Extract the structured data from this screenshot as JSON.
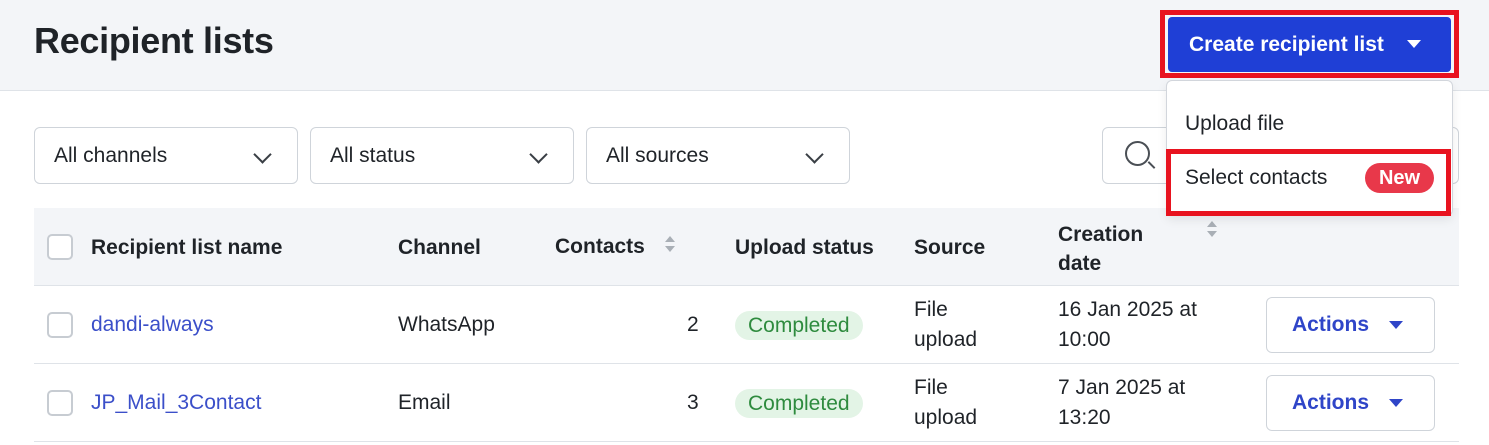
{
  "header": {
    "title": "Recipient lists",
    "create_label": "Create recipient list"
  },
  "dropdown": {
    "items": [
      {
        "label": "Upload file"
      },
      {
        "label": "Select contacts",
        "badge": "New"
      }
    ]
  },
  "filters": [
    {
      "label": "All channels"
    },
    {
      "label": "All status"
    },
    {
      "label": "All sources"
    }
  ],
  "table": {
    "headers": {
      "name": "Recipient list name",
      "channel": "Channel",
      "contacts": "Contacts",
      "upload_status": "Upload status",
      "source": "Source",
      "creation_line1": "Creation",
      "creation_line2": "date"
    },
    "rows": [
      {
        "name": "dandi-always",
        "channel": "WhatsApp",
        "contacts": "2",
        "status": "Completed",
        "source_line1": "File",
        "source_line2": "upload",
        "date_line1": "16 Jan 2025 at",
        "date_line2": "10:00",
        "actions": "Actions"
      },
      {
        "name": "JP_Mail_3Contact",
        "channel": "Email",
        "contacts": "3",
        "status": "Completed",
        "source_line1": "File",
        "source_line2": "upload",
        "date_line1": "7 Jan 2025 at",
        "date_line2": "13:20",
        "actions": "Actions"
      }
    ]
  },
  "colors": {
    "primary": "#1f3fd6",
    "highlight": "#e8131f",
    "badge": "#e8384a",
    "status_bg": "#e3f4e6",
    "status_text": "#2e8b3e",
    "link": "#3b4fc9"
  }
}
